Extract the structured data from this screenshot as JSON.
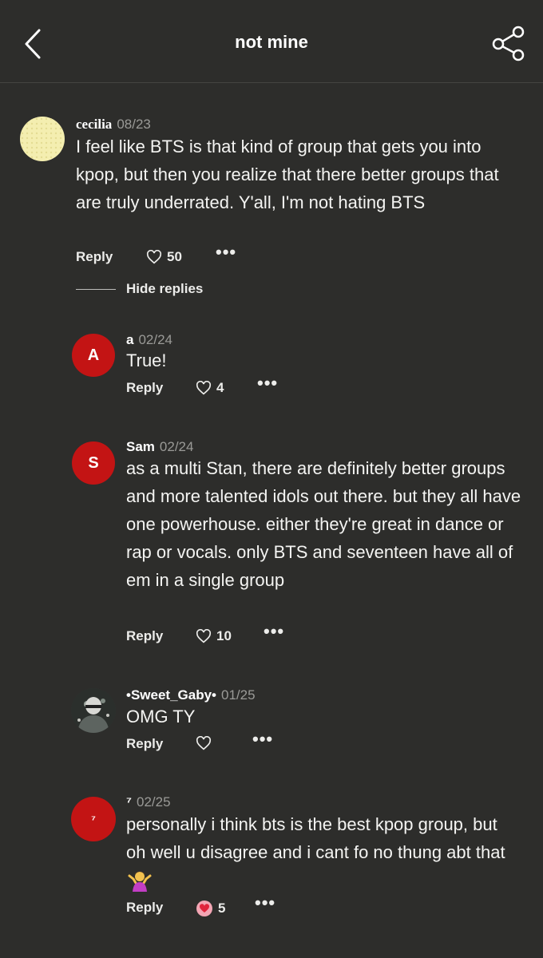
{
  "header": {
    "title": "not mine"
  },
  "comment": {
    "user": "cecilia",
    "date": "08/23",
    "text": "I feel like BTS is that kind of group that gets you into kpop, but then you realize that there better groups that are truly underrated. Y'all, I'm not hating BTS",
    "reply_label": "Reply",
    "likes": "50"
  },
  "hide_replies_label": "Hide replies",
  "replies": [
    {
      "avatar_letter": "A",
      "user": "a",
      "date": "02/24",
      "text": "True!",
      "reply_label": "Reply",
      "likes": "4"
    },
    {
      "avatar_letter": "S",
      "user": "Sam",
      "date": "02/24",
      "text": "as a multi Stan, there are definitely better groups and more talented idols out there. but they all have one powerhouse. either they're great in dance or rap or vocals. only BTS and seventeen have all of em in a single group",
      "reply_label": "Reply",
      "likes": "10"
    },
    {
      "user": "•Sweet_Gaby•",
      "date": "01/25",
      "text": "OMG TY",
      "reply_label": "Reply",
      "likes": ""
    },
    {
      "avatar_letter": "⁷",
      "user": "⁷",
      "date": "02/25",
      "text": "personally i think bts is the best kpop group, but oh well u disagree and i cant fo no thung abt that",
      "reply_label": "Reply",
      "likes": "5"
    }
  ],
  "colors": {
    "background": "#2d2d2b",
    "avatar_red": "#c31414",
    "avatar_cream": "#f4eeb0"
  },
  "icons": {
    "back": "chevron-left-icon",
    "share": "share-icon",
    "like": "heart-icon",
    "more": "more-dots-icon",
    "emoji": "person-shrugging-emoji"
  }
}
